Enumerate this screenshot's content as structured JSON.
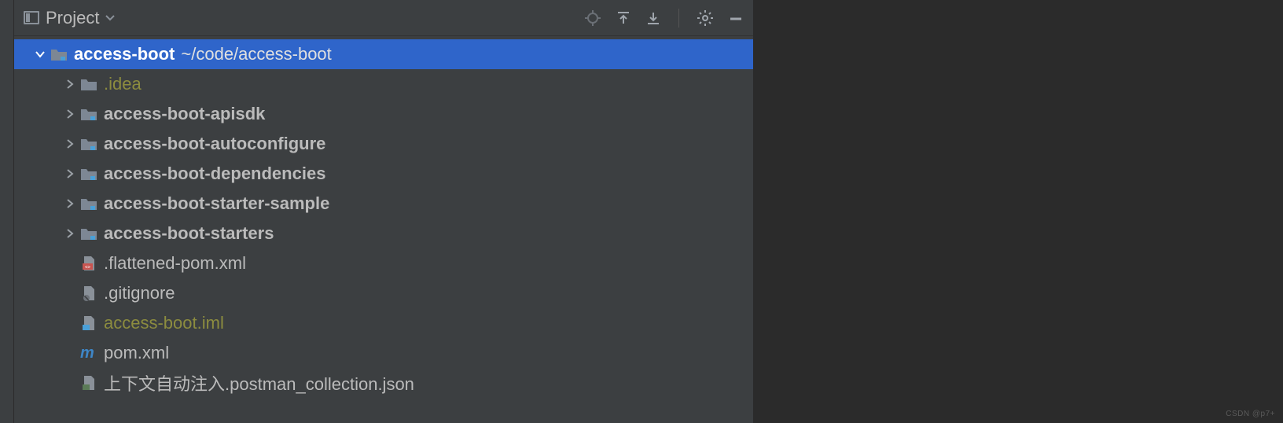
{
  "panel": {
    "title": "Project"
  },
  "tree": {
    "root": {
      "name": "access-boot",
      "path": "~/code/access-boot"
    },
    "children": [
      {
        "name": ".idea",
        "type": "folder-plain",
        "expandable": true,
        "colorClass": "idea-color"
      },
      {
        "name": "access-boot-apisdk",
        "type": "module",
        "expandable": true,
        "bold": true
      },
      {
        "name": "access-boot-autoconfigure",
        "type": "module",
        "expandable": true,
        "bold": true
      },
      {
        "name": "access-boot-dependencies",
        "type": "module",
        "expandable": true,
        "bold": true
      },
      {
        "name": "access-boot-starter-sample",
        "type": "module",
        "expandable": true,
        "bold": true
      },
      {
        "name": "access-boot-starters",
        "type": "module",
        "expandable": true,
        "bold": true
      },
      {
        "name": ".flattened-pom.xml",
        "type": "file-xml",
        "expandable": false
      },
      {
        "name": ".gitignore",
        "type": "file-ignore",
        "expandable": false
      },
      {
        "name": "access-boot.iml",
        "type": "file-iml",
        "expandable": false,
        "colorClass": "iml-color"
      },
      {
        "name": "pom.xml",
        "type": "file-maven",
        "expandable": false
      },
      {
        "name": "上下文自动注入.postman_collection.json",
        "type": "file-json",
        "expandable": false
      }
    ]
  },
  "watermark": "CSDN @p7+"
}
